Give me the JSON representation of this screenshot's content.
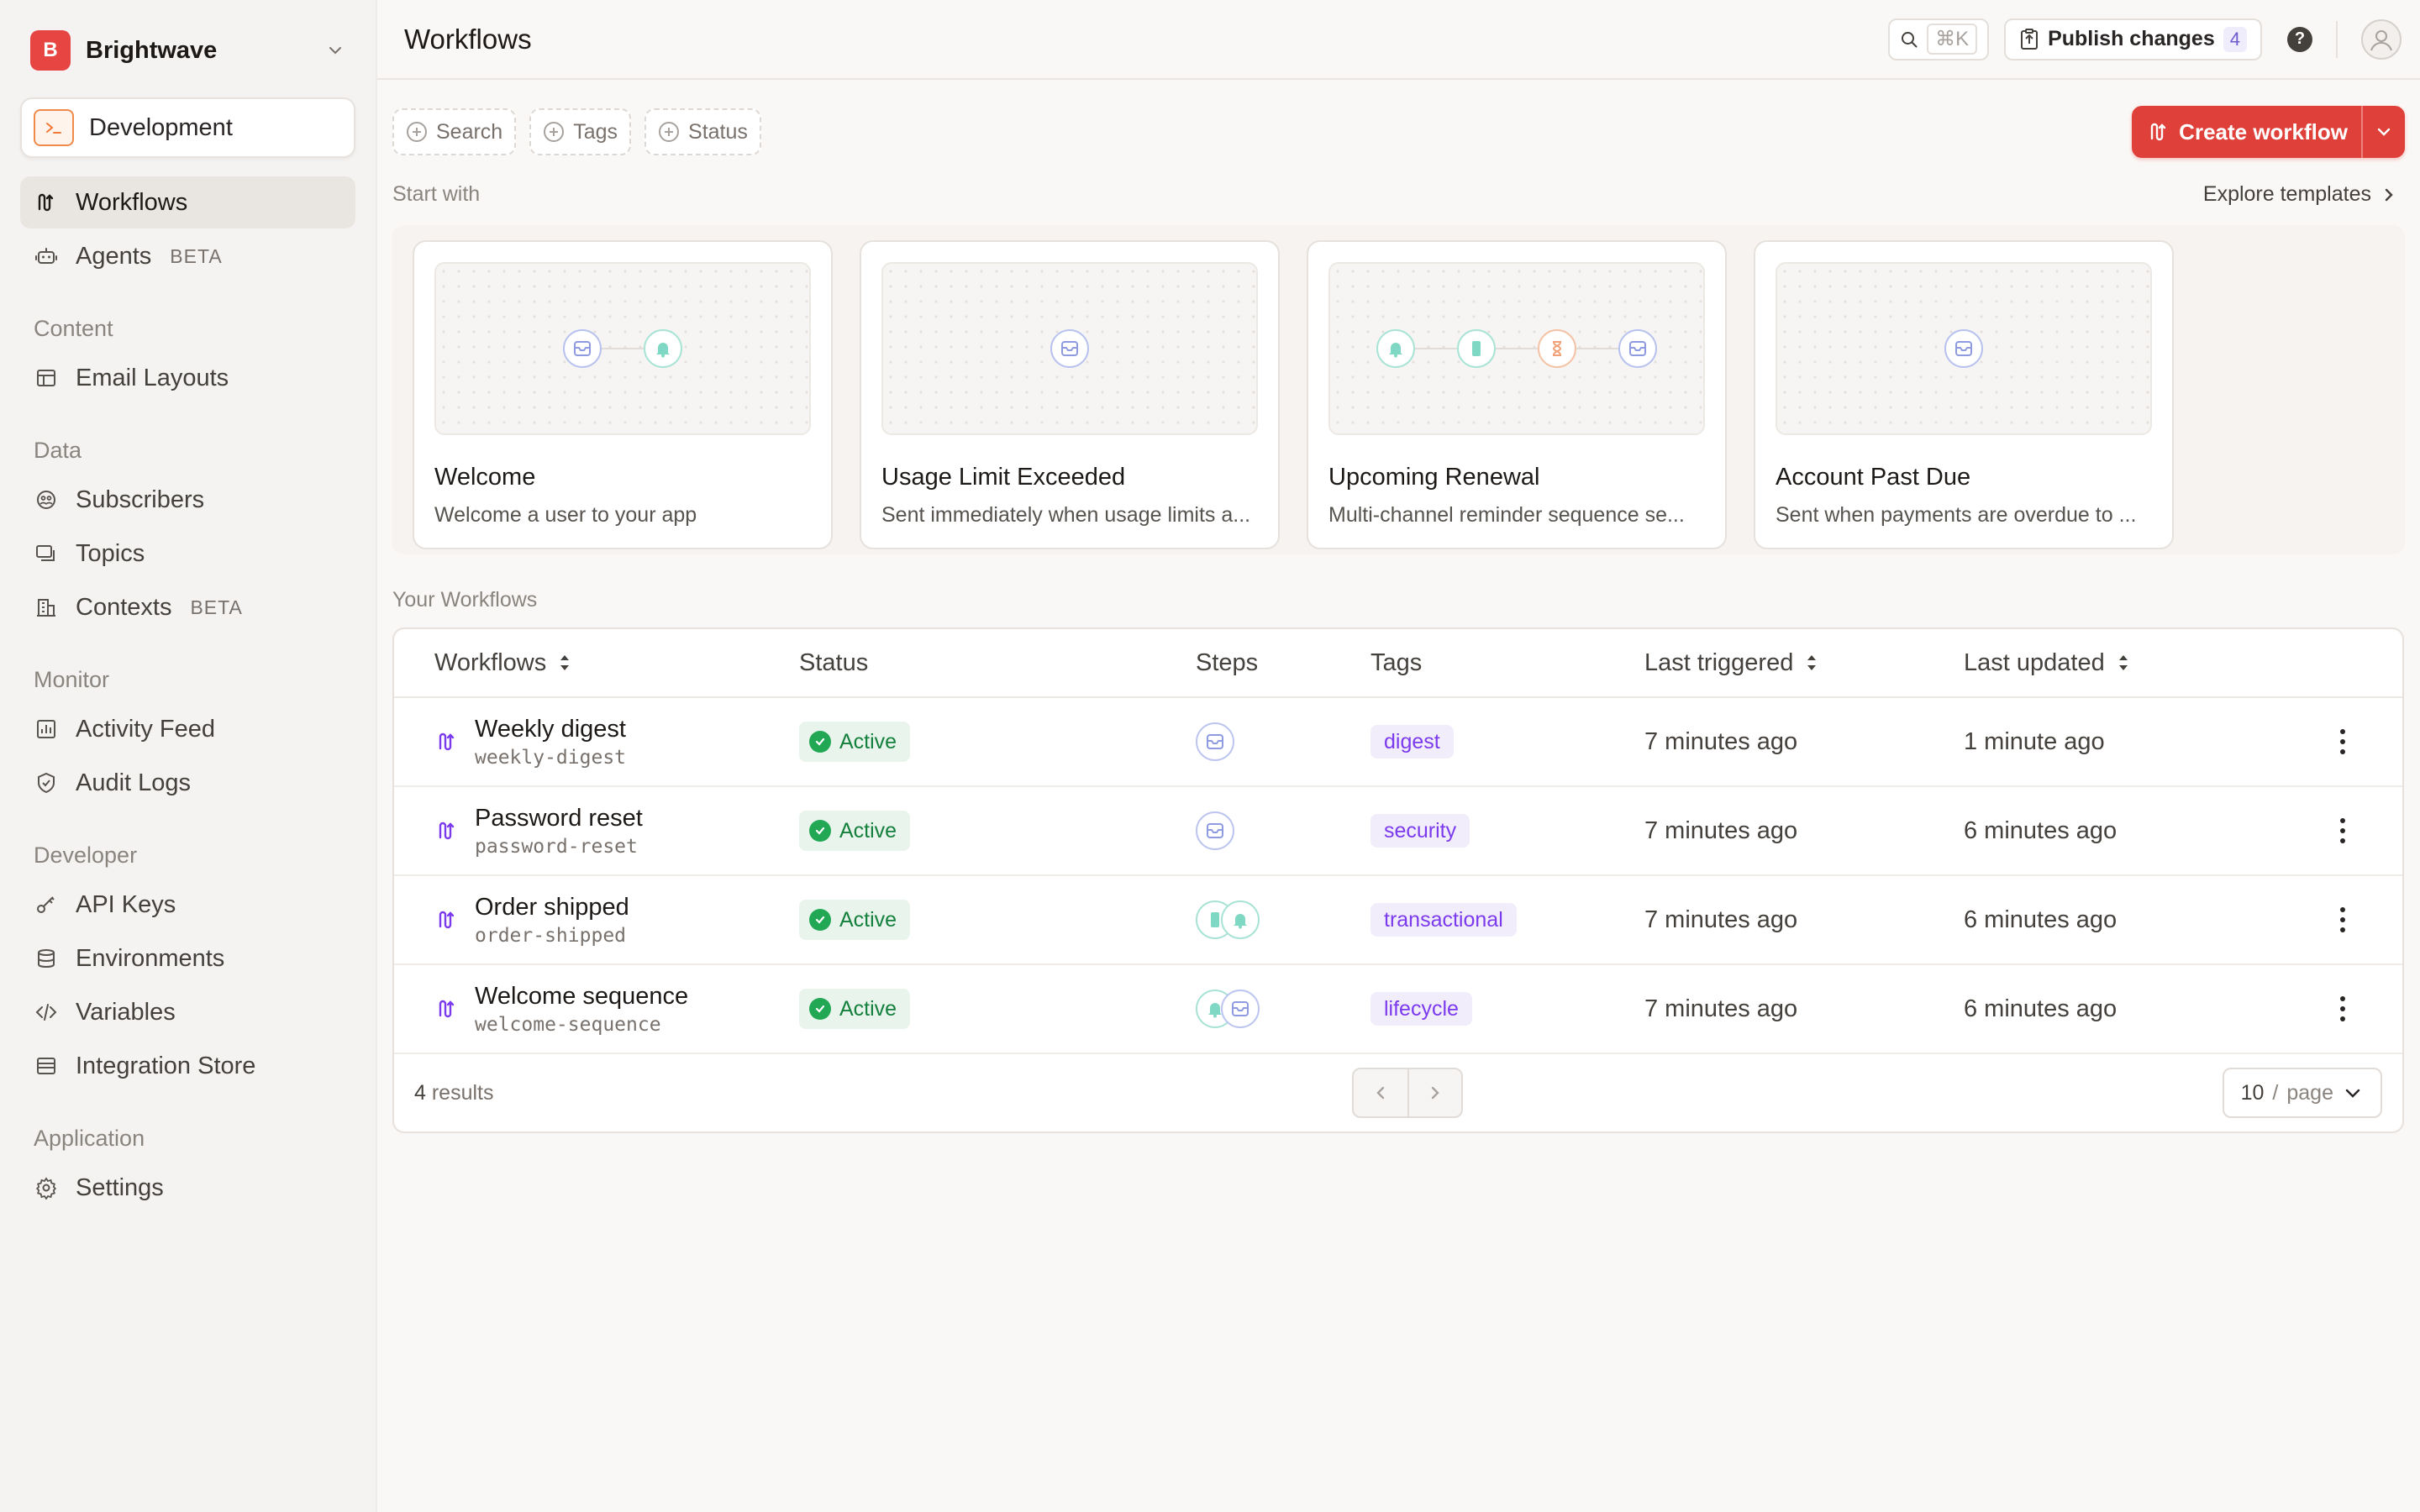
{
  "org": {
    "initial": "B",
    "name": "Brightwave"
  },
  "environment": {
    "label": "Development"
  },
  "nav": {
    "top": [
      {
        "label": "Workflows",
        "icon": "workflow-icon",
        "active": true
      },
      {
        "label": "Agents",
        "icon": "robot-icon",
        "badge": "BETA"
      }
    ],
    "sections": [
      {
        "title": "Content",
        "items": [
          {
            "label": "Email Layouts",
            "icon": "layout-icon"
          }
        ]
      },
      {
        "title": "Data",
        "items": [
          {
            "label": "Subscribers",
            "icon": "users-icon"
          },
          {
            "label": "Topics",
            "icon": "topics-icon"
          },
          {
            "label": "Contexts",
            "icon": "building-icon",
            "badge": "BETA"
          }
        ]
      },
      {
        "title": "Monitor",
        "items": [
          {
            "label": "Activity Feed",
            "icon": "chart-icon"
          },
          {
            "label": "Audit Logs",
            "icon": "shield-icon"
          }
        ]
      },
      {
        "title": "Developer",
        "items": [
          {
            "label": "API Keys",
            "icon": "key-icon"
          },
          {
            "label": "Environments",
            "icon": "database-icon"
          },
          {
            "label": "Variables",
            "icon": "code-icon"
          },
          {
            "label": "Integration Store",
            "icon": "store-icon"
          }
        ]
      },
      {
        "title": "Application",
        "items": [
          {
            "label": "Settings",
            "icon": "gear-icon"
          }
        ]
      }
    ]
  },
  "topbar": {
    "title": "Workflows",
    "search_shortcut": "⌘K",
    "publish_label": "Publish changes",
    "publish_count": "4"
  },
  "filters": {
    "search": "Search",
    "tags": "Tags",
    "status": "Status"
  },
  "create_button": "Create workflow",
  "start_with": {
    "title": "Start with",
    "explore": "Explore templates"
  },
  "templates": [
    {
      "name": "Welcome",
      "desc": "Welcome a user to your app"
    },
    {
      "name": "Usage Limit Exceeded",
      "desc": "Sent immediately when usage limits a..."
    },
    {
      "name": "Upcoming Renewal",
      "desc": "Multi-channel reminder sequence se..."
    },
    {
      "name": "Account Past Due",
      "desc": "Sent when payments are overdue to ..."
    }
  ],
  "your_workflows_title": "Your Workflows",
  "table": {
    "headers": {
      "workflows": "Workflows",
      "status": "Status",
      "steps": "Steps",
      "tags": "Tags",
      "last_triggered": "Last triggered",
      "last_updated": "Last updated"
    },
    "rows": [
      {
        "name": "Weekly digest",
        "slug": "weekly-digest",
        "status": "Active",
        "tag": "digest",
        "last_triggered": "7 minutes ago",
        "last_updated": "1 minute ago"
      },
      {
        "name": "Password reset",
        "slug": "password-reset",
        "status": "Active",
        "tag": "security",
        "last_triggered": "7 minutes ago",
        "last_updated": "6 minutes ago"
      },
      {
        "name": "Order shipped",
        "slug": "order-shipped",
        "status": "Active",
        "tag": "transactional",
        "last_triggered": "7 minutes ago",
        "last_updated": "6 minutes ago"
      },
      {
        "name": "Welcome sequence",
        "slug": "welcome-sequence",
        "status": "Active",
        "tag": "lifecycle",
        "last_triggered": "7 minutes ago",
        "last_updated": "6 minutes ago"
      }
    ],
    "footer": {
      "count": "4",
      "results_label": "results",
      "per_page_value": "10",
      "per_page_label": "page"
    }
  },
  "colors": {
    "accent": "#e0403a",
    "active_green": "#22a755",
    "tag_purple": "#7c3aed"
  }
}
